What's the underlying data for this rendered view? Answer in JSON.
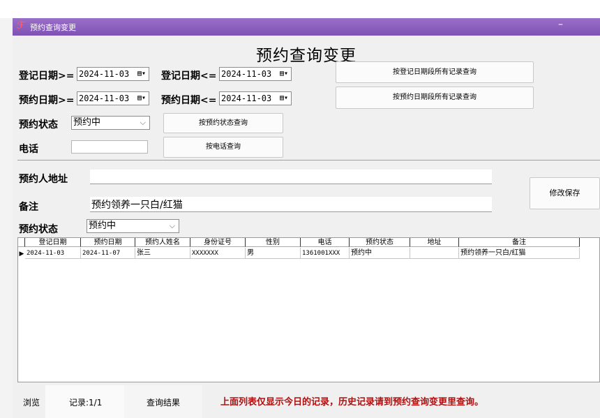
{
  "window": {
    "title": "预约查询变更",
    "minimize": "–"
  },
  "form_title": "预约查询变更",
  "filters": {
    "reg_date_from_label": "登记日期>=",
    "reg_date_from": "2024-11-03",
    "reg_date_to_label": "登记日期<=",
    "reg_date_to": "2024-11-03",
    "appt_date_from_label": "预约日期>=",
    "appt_date_from": "2024-11-03",
    "appt_date_to_label": "预约日期<=",
    "appt_date_to": "2024-11-03",
    "status_label": "预约状态",
    "status_value": "预约中",
    "phone_label": "电话",
    "phone_value": ""
  },
  "buttons": {
    "by_reg_date": "按登记日期段所有记录查询",
    "by_appt_date": "按预约日期段所有记录查询",
    "by_status": "按预约状态查询",
    "by_phone": "按电话查询",
    "save": "修改保存"
  },
  "detail": {
    "address_label": "预约人地址",
    "address_value": "",
    "note_label": "备注",
    "note_value": "预约领养一只白/红猫",
    "status_label": "预约状态",
    "status_value": "预约中"
  },
  "table": {
    "columns": [
      "登记日期",
      "预约日期",
      "预约人姓名",
      "身份证号",
      "性别",
      "电话",
      "预约状态",
      "地址",
      "备注"
    ],
    "rows": [
      [
        "2024-11-03",
        "2024-11-07",
        "张三",
        "XXXXXXX",
        "男",
        "1361001XXX",
        "预约中",
        "",
        "预约领养一只白/红猫"
      ]
    ]
  },
  "statusbar": {
    "browse": "浏览",
    "records": "记录:1/1",
    "results": "查询结果",
    "notice": "上面列表仅显示今日的记录，历史记录请到预约查询变更里查询。"
  },
  "colors": {
    "titlebar": "#7d52b5",
    "notice": "#b01010"
  }
}
